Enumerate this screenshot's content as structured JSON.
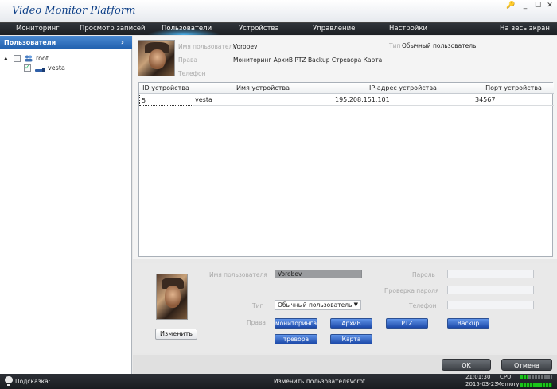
{
  "app": {
    "title": "Video Monitor Platform"
  },
  "window_controls": {
    "settings": "🔑",
    "minimize": "_",
    "maximize": "☐",
    "close": "✕"
  },
  "menu": {
    "items": [
      {
        "label": "Мониторинг"
      },
      {
        "label": "Просмотр записей"
      },
      {
        "label": "Пользователи"
      },
      {
        "label": "Устройства"
      },
      {
        "label": "Управление"
      },
      {
        "label": "Настройки"
      },
      {
        "label": "На весь экран"
      }
    ],
    "active_index": 2
  },
  "sidebar": {
    "title": "Пользователи",
    "arrow": "›",
    "tree": [
      {
        "expander": "▲",
        "label": "root",
        "checked": false
      },
      {
        "label": "vesta",
        "checked": true
      }
    ]
  },
  "user_info": {
    "username_label": "Имя пользователя",
    "username": "Vorobev",
    "type_label": "Тип",
    "type": "Обычный пользователь",
    "rights_label": "Права",
    "rights": "Мониторинг АрхиВ PTZ Backup Стревора Карта",
    "phone_label": "Телефон"
  },
  "device_table": {
    "columns": [
      "ID устройства",
      "Имя устройства",
      "IP-адрес устройства",
      "Порт устройства"
    ],
    "rows": [
      [
        "5",
        "vesta",
        "195.208.151.101",
        "34567"
      ]
    ]
  },
  "edit_form": {
    "username_label": "Имя пользователя",
    "username_value": "Vorobev",
    "password_label": "Пароль",
    "confirm_label": "Проверка пароля",
    "type_label": "Тип",
    "type_value": "Обычный пользователь",
    "phone_label": "Телефон",
    "rights_label": "Права",
    "rights_buttons": [
      "мониторинга",
      "АрхиВ",
      "PTZ",
      "Backup",
      "тревора",
      "Карта"
    ],
    "change_button": "Изменить"
  },
  "actions": {
    "ok": "OK",
    "cancel": "Отмена"
  },
  "statusbar": {
    "hint_label": "Подсказка:",
    "message": "Изменить пользователяVorot",
    "time": "21:01:30",
    "date": "2015-03-23",
    "cpu_label": "CPU",
    "memory_label": "Memory"
  },
  "colors": {
    "accent": "#1f5fad",
    "menubar": "#1d2024",
    "button_blue": "#1c49a9"
  }
}
